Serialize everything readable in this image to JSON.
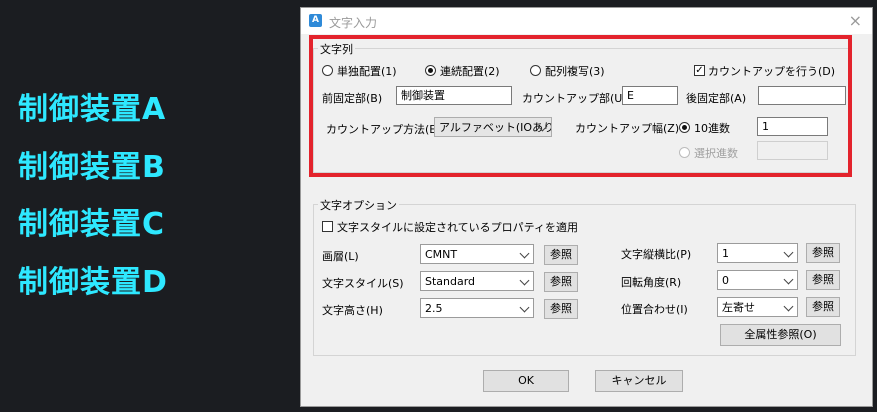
{
  "background_labels": [
    "制御装置A",
    "制御装置B",
    "制御装置C",
    "制御装置D"
  ],
  "dialog": {
    "title": "文字入力",
    "close_symbol": "×",
    "string_group": {
      "title": "文字列",
      "radio_single": "単独配置(1)",
      "radio_continuous": "連続配置(2)",
      "radio_array": "配列複写(3)",
      "countup_check": "カウントアップを行う(D)",
      "prefix_label": "前固定部(B)",
      "prefix_value": "制御装置",
      "countup_part_label": "カウントアップ部(U)",
      "countup_part_value": "E",
      "suffix_label": "後固定部(A)",
      "suffix_value": "",
      "method_label": "カウントアップ方法(E)",
      "method_value": "アルファベット(IOあり",
      "step_label": "カウントアップ幅(Z)",
      "decimal_label": "10進数",
      "step_value": "1",
      "select_label": "選択進数",
      "select_value": ""
    },
    "options_group": {
      "title": "文字オプション",
      "apply_style_check": "文字スタイルに設定されているプロパティを適用",
      "layer_label": "画層(L)",
      "layer_value": "CMNT",
      "style_label": "文字スタイル(S)",
      "style_value": "Standard",
      "height_label": "文字高さ(H)",
      "height_value": "2.5",
      "ratio_label": "文字縦横比(P)",
      "ratio_value": "1",
      "angle_label": "回転角度(R)",
      "angle_value": "0",
      "align_label": "位置合わせ(I)",
      "align_value": "左寄せ",
      "ref_label": "参照",
      "all_props_label": "全属性参照(O)"
    },
    "ok_label": "OK",
    "cancel_label": "キャンセル"
  },
  "colors": {
    "highlight_border": "#e3232c",
    "label_cyan": "#2ee8ff"
  }
}
